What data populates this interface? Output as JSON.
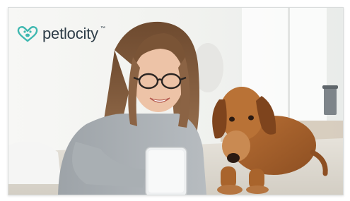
{
  "brand": {
    "name": "petlocity",
    "trademark": "™",
    "accent_color": "#3fb8b0",
    "text_color": "#2e3d48",
    "icon": "heart-paw-logo-icon"
  },
  "hero": {
    "image": "woman-with-glasses-lying-on-rug-holding-phone-next-to-brown-dachshund"
  }
}
